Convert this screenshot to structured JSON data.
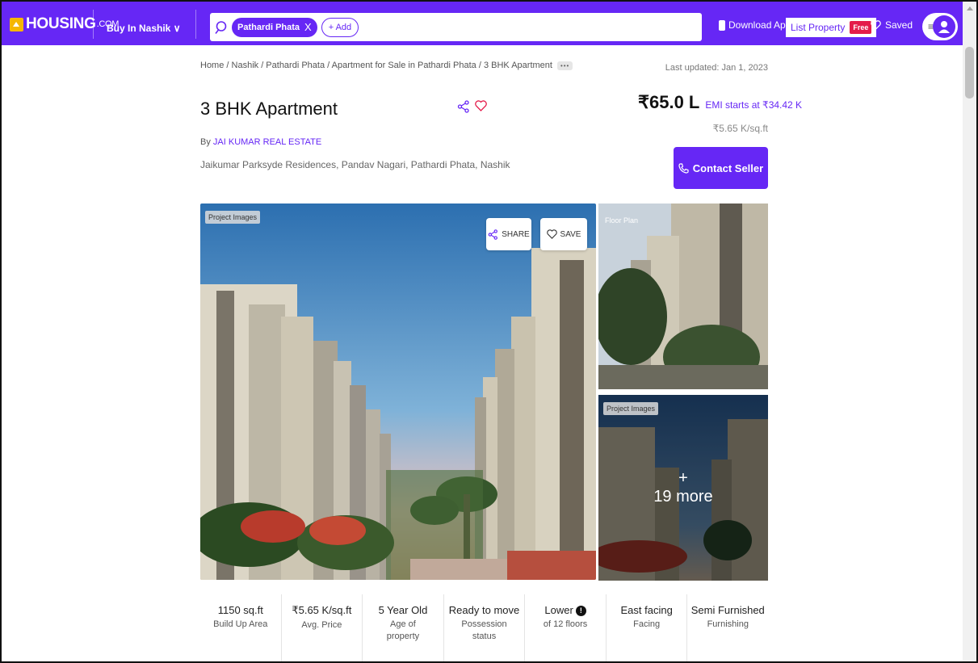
{
  "header": {
    "logo": "HOUSING",
    "logo_suffix": ".COM",
    "city_menu": "Buy In Nashik ∨",
    "search_chip": "Pathardi Phata",
    "search_chip_close": "X",
    "add_chip": "+ Add",
    "download_app": "Download App",
    "list_property": "List Property",
    "free_badge": "Free",
    "saved": "Saved",
    "menu_glyph": "≡"
  },
  "listing": {
    "breadcrumb": "Home / Nashik / Pathardi Phata / Apartment for Sale in Pathardi Phata / 3 BHK Apartment",
    "breadcrumb_more": "•••",
    "last_updated": "Last updated: Jan 1, 2023",
    "title": "3 BHK Apartment",
    "price": "₹65.0 L",
    "emi": "EMI starts at ₹34.42 K",
    "price_per_sqft": "₹5.65 K/sq.ft",
    "by_prefix": "By",
    "seller": "JAI KUMAR REAL ESTATE",
    "address": "Jaikumar Parksyde Residences, Pandav Nagari, Pathardi Phata, Nashik",
    "contact_button": "Contact Seller"
  },
  "gallery": {
    "main_tag": "Project Images",
    "share": "SHARE",
    "save": "SAVE",
    "side1_tag": "Floor Plan",
    "side2_tag": "Project Images",
    "more_plus": "+",
    "more_text": "19 more"
  },
  "specs": [
    {
      "value": "1150 sq.ft",
      "label": "Build Up Area"
    },
    {
      "value": "₹5.65 K/sq.ft",
      "label": "Avg. Price"
    },
    {
      "value": "5 Year Old",
      "label": "Age of property"
    },
    {
      "value": "Ready to move",
      "label": "Possession status"
    },
    {
      "value": "Lower",
      "label": "of 12 floors"
    },
    {
      "value": "East facing",
      "label": "Facing"
    },
    {
      "value": "Semi Furnished",
      "label": "Furnishing"
    }
  ],
  "colors": {
    "brand": "#6627f5",
    "free_badge": "#e41b4a",
    "logo_box": "#f5b700"
  }
}
